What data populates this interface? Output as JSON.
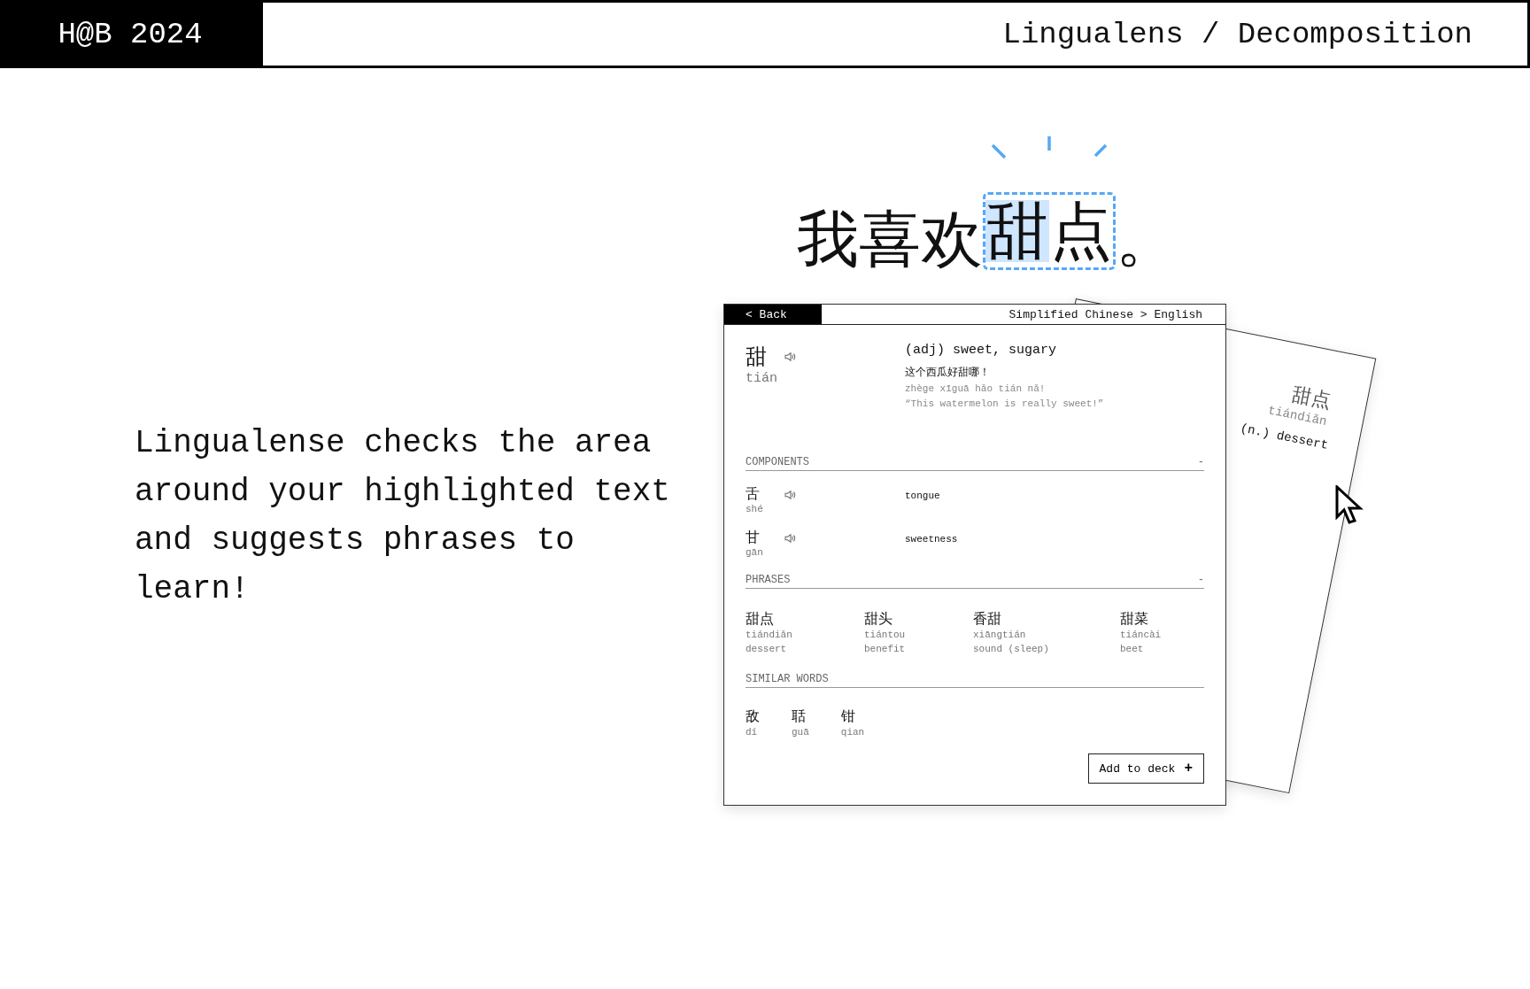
{
  "header": {
    "badge": "H@B 2024",
    "title": "Lingualens / Decomposition"
  },
  "description": "Lingualense checks the area around your highlighted text and suggests phrases to learn!",
  "sentence": {
    "prefix": "我喜欢",
    "phrase": [
      {
        "text": "甜",
        "selected": true
      },
      {
        "text": "点",
        "selected": false
      }
    ],
    "suffix": "。"
  },
  "card": {
    "back_button": "< Back",
    "language": "Simplified Chinese > English",
    "entry": {
      "hanzi": "甜",
      "pinyin": "tián",
      "definition": "(adj) sweet, sugary",
      "example": {
        "hanzi": "这个西瓜好甜哪！",
        "pinyin": "zhège xīguā hǎo tián nǎ!",
        "translation": "“This watermelon is really sweet!”"
      }
    },
    "components": {
      "title": "COMPONENTS",
      "toggle": "-",
      "items": [
        {
          "hanzi": "舌",
          "pinyin": "shé",
          "meaning": "tongue"
        },
        {
          "hanzi": "甘",
          "pinyin": "gān",
          "meaning": "sweetness"
        }
      ]
    },
    "phrases": {
      "title": "PHRASES",
      "toggle": "-",
      "items": [
        {
          "hanzi": "甜点",
          "pinyin": "tiándiǎn",
          "meaning": "dessert"
        },
        {
          "hanzi": "甜头",
          "pinyin": "tiántou",
          "meaning": "benefit"
        },
        {
          "hanzi": "香甜",
          "pinyin": "xiāngtián",
          "meaning": "sound (sleep)"
        },
        {
          "hanzi": "甜菜",
          "pinyin": "tiáncài",
          "meaning": "beet"
        }
      ]
    },
    "similar_words": {
      "title": "SIMILAR WORDS",
      "items": [
        {
          "hanzi": "敌",
          "pinyin": "dí"
        },
        {
          "hanzi": "聒",
          "pinyin": "guā"
        },
        {
          "hanzi": "钳",
          "pinyin": "qian"
        }
      ]
    },
    "add_button": {
      "label": "Add to deck",
      "icon": "+"
    }
  },
  "back_card": {
    "hanzi": "甜点",
    "pinyin": "tiándiǎn",
    "definition": "(n.) dessert"
  }
}
